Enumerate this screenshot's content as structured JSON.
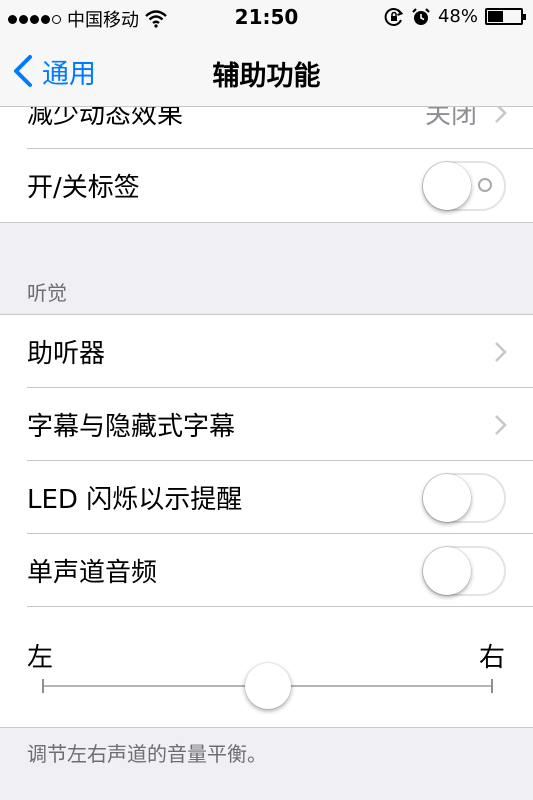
{
  "status_bar": {
    "carrier": "中国移动",
    "time": "21:50",
    "battery_percent_label": "48%",
    "battery_level": 0.48,
    "icons": [
      "signal-dots-icon",
      "wifi-icon",
      "rotation-lock-icon",
      "alarm-icon",
      "battery-icon"
    ]
  },
  "nav": {
    "back_label": "通用",
    "title": "辅助功能"
  },
  "vision_tail": {
    "rows": [
      {
        "label": "减少动态效果",
        "value": "关闭"
      },
      {
        "label": "开/关标签",
        "toggle": false
      }
    ]
  },
  "hearing": {
    "header": "听觉",
    "rows": [
      {
        "label": "助听器"
      },
      {
        "label": "字幕与隐藏式字幕"
      },
      {
        "label": "LED 闪烁以示提醒",
        "toggle": false
      },
      {
        "label": "单声道音频",
        "toggle": false
      }
    ],
    "balance": {
      "left_label": "左",
      "right_label": "右",
      "value": 0.5
    },
    "footer": "调节左右声道的音量平衡。"
  },
  "colors": {
    "accent": "#007aff",
    "background": "#efeff4",
    "separator": "#c8c7cc",
    "secondary_text": "#6d6d72"
  }
}
